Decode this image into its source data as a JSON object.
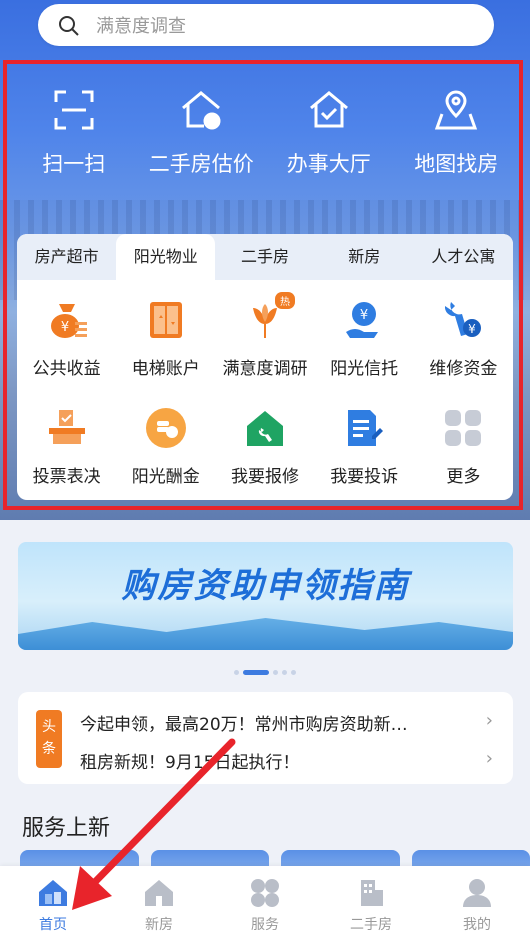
{
  "search": {
    "placeholder": "满意度调查"
  },
  "top_actions": [
    {
      "label": "扫一扫",
      "icon": "scan-icon"
    },
    {
      "label": "二手房估价",
      "icon": "house-valuation-icon"
    },
    {
      "label": "办事大厅",
      "icon": "service-hall-icon"
    },
    {
      "label": "地图找房",
      "icon": "map-pin-icon"
    }
  ],
  "tabs": [
    "房产超市",
    "阳光物业",
    "二手房",
    "新房",
    "人才公寓"
  ],
  "active_tab": "阳光物业",
  "services": [
    {
      "label": "公共收益",
      "icon": "money-bag-icon"
    },
    {
      "label": "电梯账户",
      "icon": "elevator-icon"
    },
    {
      "label": "满意度调研",
      "icon": "flower-icon",
      "badge": "热"
    },
    {
      "label": "阳光信托",
      "icon": "hand-coin-icon"
    },
    {
      "label": "维修资金",
      "icon": "wrench-coin-icon"
    },
    {
      "label": "投票表决",
      "icon": "ballot-box-icon"
    },
    {
      "label": "阳光酬金",
      "icon": "coin-stack-icon"
    },
    {
      "label": "我要报修",
      "icon": "repair-house-icon"
    },
    {
      "label": "我要投诉",
      "icon": "complaint-doc-icon"
    },
    {
      "label": "更多",
      "icon": "more-grid-icon"
    }
  ],
  "banner": {
    "title": "购房资助申领指南"
  },
  "news": {
    "tag": "头条",
    "items": [
      "今起申领，最高20万！常州市购房资助新…",
      "租房新规！9月15日起执行！"
    ]
  },
  "section_title": "服务上新",
  "tabbar": [
    {
      "label": "首页",
      "icon": "home-icon",
      "active": true
    },
    {
      "label": "新房",
      "icon": "new-house-icon"
    },
    {
      "label": "服务",
      "icon": "service-grid-icon"
    },
    {
      "label": "二手房",
      "icon": "building-icon"
    },
    {
      "label": "我的",
      "icon": "profile-icon"
    }
  ],
  "colors": {
    "accent": "#3d7be0",
    "highlight_box": "#e8242b",
    "orange": "#f07b23",
    "green": "#1fa463"
  }
}
